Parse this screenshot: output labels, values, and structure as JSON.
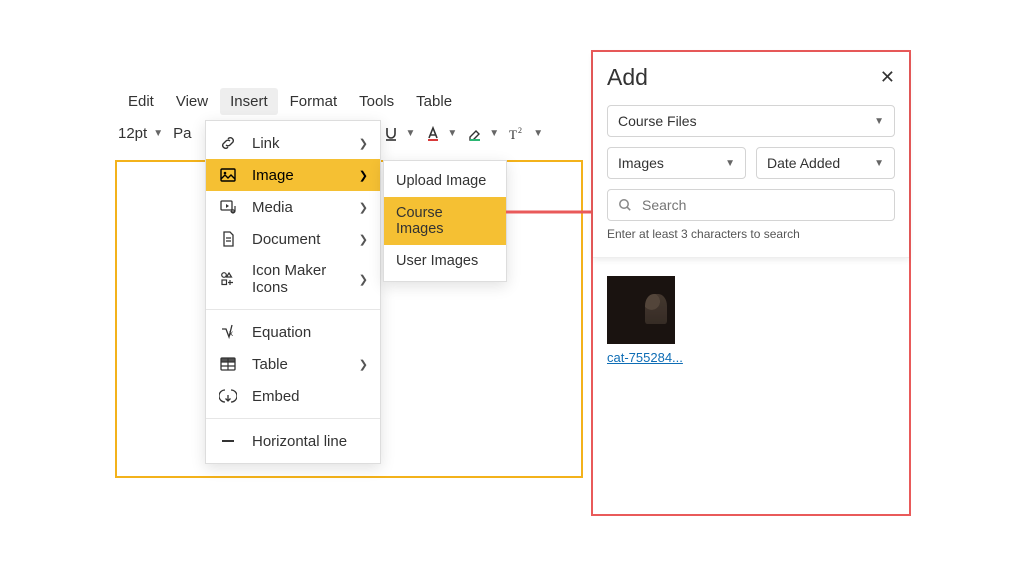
{
  "menubar": {
    "items": [
      "Edit",
      "View",
      "Insert",
      "Format",
      "Tools",
      "Table"
    ],
    "active": "Insert"
  },
  "toolbar": {
    "font_size": "12pt",
    "paragraph_stub": "Pa"
  },
  "insert_menu": {
    "link": "Link",
    "image": "Image",
    "media": "Media",
    "document": "Document",
    "icon_maker": "Icon Maker Icons",
    "equation": "Equation",
    "table": "Table",
    "embed": "Embed",
    "hr": "Horizontal line"
  },
  "image_submenu": {
    "upload": "Upload Image",
    "course": "Course Images",
    "user": "User Images"
  },
  "panel": {
    "title": "Add",
    "select_files": "Course Files",
    "select_type": "Images",
    "select_sort": "Date Added",
    "search_placeholder": "Search",
    "hint": "Enter at least 3 characters to search",
    "thumb_label": "cat-755284..."
  }
}
